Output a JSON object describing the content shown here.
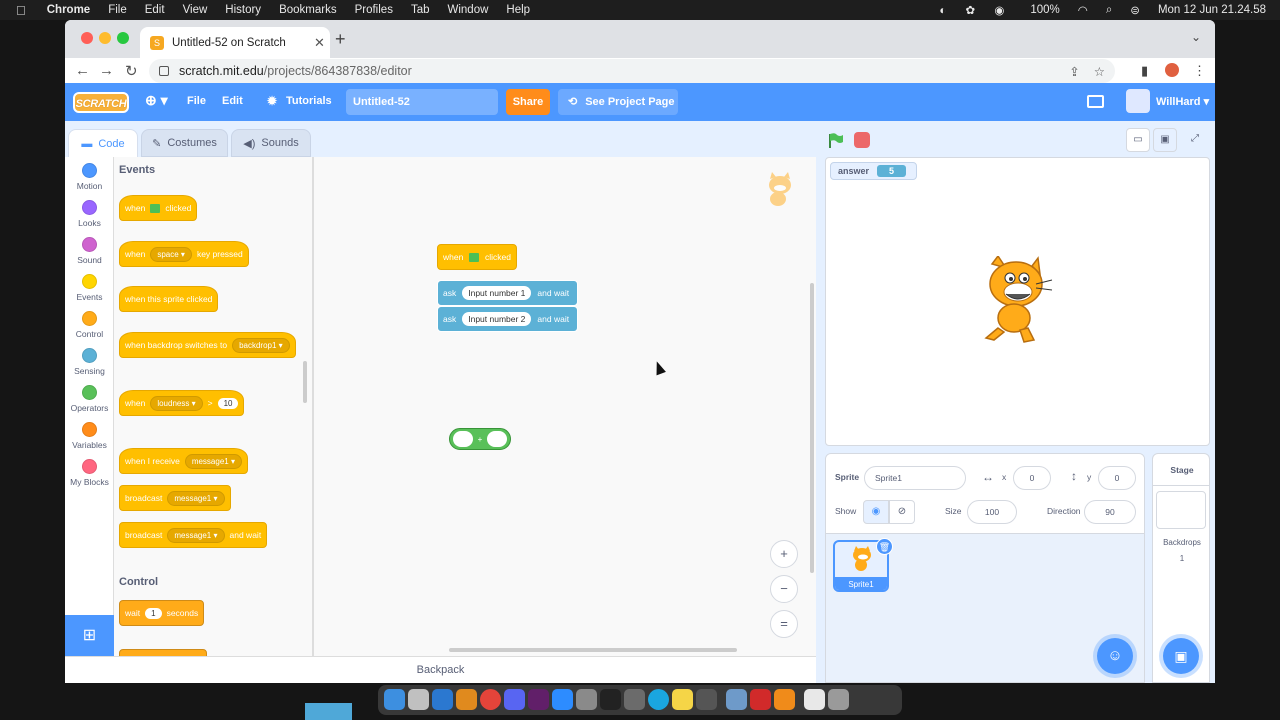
{
  "menubar": {
    "app": "Chrome",
    "items": [
      "File",
      "Edit",
      "View",
      "History",
      "Bookmarks",
      "Profiles",
      "Tab",
      "Window",
      "Help"
    ],
    "battery": "100%",
    "clock": "Mon 12 Jun  21.24.58"
  },
  "browser": {
    "tab_title": "Untitled-52 on Scratch",
    "url_domain": "scratch.mit.edu",
    "url_path": "/projects/864387838/editor"
  },
  "scratch_menu": {
    "logo": "SCRATCH",
    "file": "File",
    "edit": "Edit",
    "tutorials": "Tutorials",
    "project_title": "Untitled-52",
    "share": "Share",
    "see_project": "See Project Page",
    "username": "WillHard"
  },
  "editor_tabs": {
    "code": "Code",
    "costumes": "Costumes",
    "sounds": "Sounds"
  },
  "categories": [
    {
      "label": "Motion",
      "color": "#4c97ff"
    },
    {
      "label": "Looks",
      "color": "#9966ff"
    },
    {
      "label": "Sound",
      "color": "#cf63cf"
    },
    {
      "label": "Events",
      "color": "#ffd500"
    },
    {
      "label": "Control",
      "color": "#ffab19"
    },
    {
      "label": "Sensing",
      "color": "#5cb1d6"
    },
    {
      "label": "Operators",
      "color": "#59c059"
    },
    {
      "label": "Variables",
      "color": "#ff8c1a"
    },
    {
      "label": "My Blocks",
      "color": "#ff6680"
    }
  ],
  "palette": {
    "events_header": "Events",
    "when_flag": {
      "a": "when",
      "b": "clicked"
    },
    "when_key": {
      "a": "when",
      "key": "space",
      "b": "key pressed"
    },
    "when_sprite": "when this sprite clicked",
    "when_backdrop": {
      "a": "when backdrop switches to",
      "dd": "backdrop1"
    },
    "when_loud": {
      "a": "when",
      "dd": "loudness",
      "op": ">",
      "val": "10"
    },
    "when_receive": {
      "a": "when I receive",
      "dd": "message1"
    },
    "broadcast": {
      "a": "broadcast",
      "dd": "message1"
    },
    "broadcast_wait": {
      "a": "broadcast",
      "dd": "message1",
      "b": "and wait"
    },
    "control_header": "Control",
    "wait": {
      "a": "wait",
      "val": "1",
      "b": "seconds"
    }
  },
  "script": {
    "hat": {
      "a": "when",
      "b": "clicked"
    },
    "ask1": {
      "a": "ask",
      "input": "Input number 1",
      "b": "and wait"
    },
    "ask2": {
      "a": "ask",
      "input": "Input number 2",
      "b": "and wait"
    },
    "operator": "+"
  },
  "zoom": {
    "in": "+",
    "out": "−",
    "reset": "="
  },
  "backpack": "Backpack",
  "stage": {
    "monitor_label": "answer",
    "monitor_value": "5"
  },
  "sprite_info": {
    "sprite_label": "Sprite",
    "sprite_name": "Sprite1",
    "x_label": "x",
    "x_value": "0",
    "y_label": "y",
    "y_value": "0",
    "show_label": "Show",
    "size_label": "Size",
    "size_value": "100",
    "direction_label": "Direction",
    "direction_value": "90"
  },
  "sprites": [
    {
      "name": "Sprite1"
    }
  ],
  "stage_pane": {
    "label": "Stage",
    "backdrops_label": "Backdrops",
    "backdrops_count": "1"
  }
}
